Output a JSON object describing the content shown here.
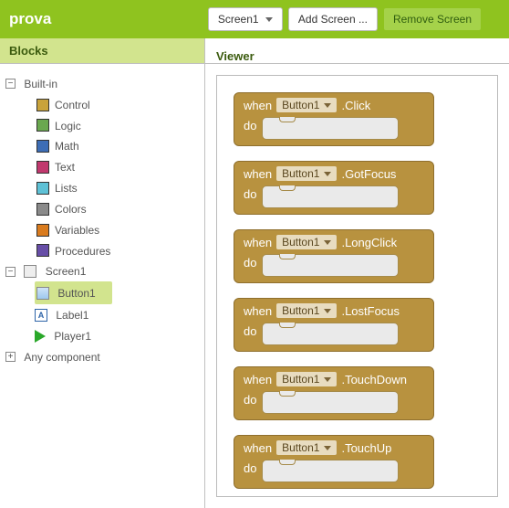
{
  "app_title": "prova",
  "topbar": {
    "screen_btn": "Screen1",
    "add_btn": "Add Screen ...",
    "remove_btn": "Remove Screen"
  },
  "panels": {
    "blocks": "Blocks",
    "viewer": "Viewer"
  },
  "tree": {
    "builtin_label": "Built-in",
    "items": [
      {
        "label": "Control",
        "color": "#c9a33b"
      },
      {
        "label": "Logic",
        "color": "#6aa84f"
      },
      {
        "label": "Math",
        "color": "#3d6db5"
      },
      {
        "label": "Text",
        "color": "#c1386e"
      },
      {
        "label": "Lists",
        "color": "#5ec1d6"
      },
      {
        "label": "Colors",
        "color": "#8a8a8a"
      },
      {
        "label": "Variables",
        "color": "#d97b1e"
      },
      {
        "label": "Procedures",
        "color": "#674ea7"
      }
    ],
    "screen": {
      "label": "Screen1",
      "children": [
        {
          "label": "Button1",
          "kind": "button",
          "selected": true
        },
        {
          "label": "Label1",
          "kind": "label"
        },
        {
          "label": "Player1",
          "kind": "player"
        }
      ]
    },
    "any_component": "Any component"
  },
  "blocks": {
    "when_kw": "when",
    "do_kw": "do",
    "target": "Button1",
    "events": [
      ".Click",
      ".GotFocus",
      ".LongClick",
      ".LostFocus",
      ".TouchDown",
      ".TouchUp"
    ]
  }
}
